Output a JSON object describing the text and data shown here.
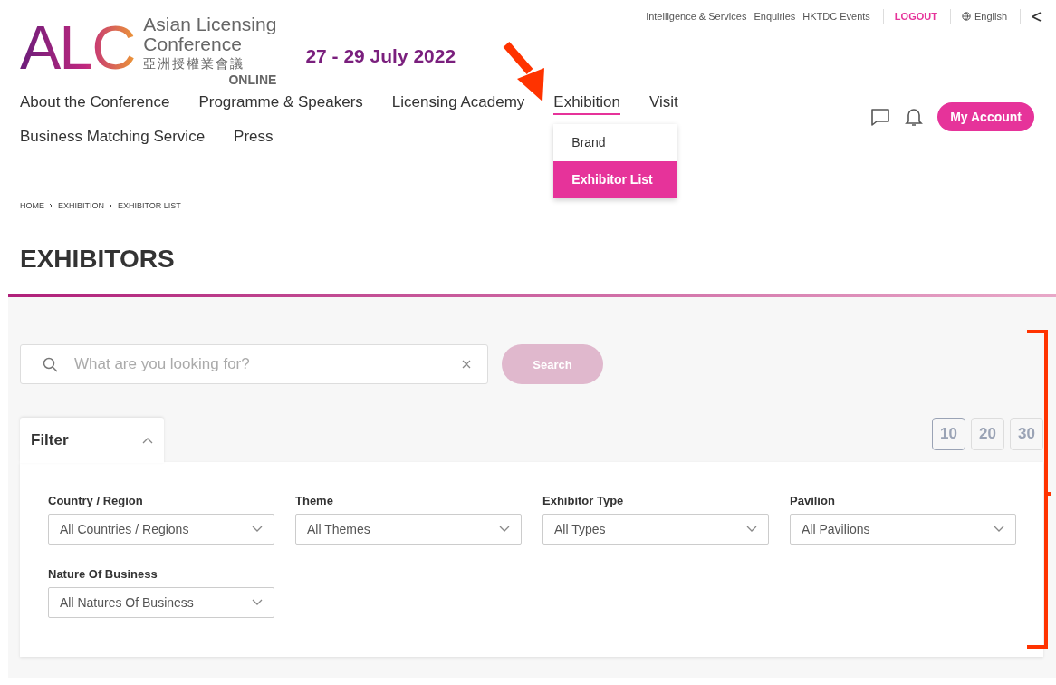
{
  "logo": {
    "mark": "ALC",
    "name_lines": [
      "Asian Licensing",
      "Conference"
    ],
    "chinese_name": "亞洲授權業會議",
    "edition": "ONLINE"
  },
  "event_date": "27 - 29 July 2022",
  "utility_links": [
    {
      "label": "Intelligence & Services",
      "kind": "link"
    },
    {
      "label": "Enquiries",
      "kind": "link"
    },
    {
      "label": "HKTDC Events",
      "kind": "link"
    },
    {
      "label": "LOGOUT",
      "kind": "logout"
    },
    {
      "label": "English",
      "kind": "language"
    },
    {
      "kind": "share"
    }
  ],
  "nav": [
    {
      "label": "About the Conference",
      "selected": false
    },
    {
      "label": "Programme & Speakers",
      "selected": false
    },
    {
      "label": "Licensing Academy",
      "selected": false
    },
    {
      "label": "Exhibition",
      "selected": true,
      "expanded": true,
      "children": [
        {
          "label": "Brand",
          "selected": false
        },
        {
          "label": "Exhibitor List",
          "selected": true
        }
      ]
    },
    {
      "label": "Visit",
      "selected": false
    },
    {
      "label": "Business Matching Service",
      "selected": false
    },
    {
      "label": "Press",
      "selected": false
    }
  ],
  "account_button": "My Account",
  "breadcrumb": [
    "HOME",
    "EXHIBITION",
    "EXHIBITOR LIST"
  ],
  "page_title": "EXHIBITORS",
  "search": {
    "placeholder": "What are you looking for?",
    "button": "Search",
    "disabled": true
  },
  "filter": {
    "title": "Filter",
    "expanded": true,
    "fields": [
      {
        "label": "Country / Region",
        "value": "All Countries / Regions"
      },
      {
        "label": "Theme",
        "value": "All Themes"
      },
      {
        "label": "Exhibitor Type",
        "value": "All Types"
      },
      {
        "label": "Pavilion",
        "value": "All Pavilions"
      },
      {
        "label": "Nature Of Business",
        "value": "All Natures Of Business"
      }
    ]
  },
  "page_sizes": [
    {
      "label": "10",
      "selected": true
    },
    {
      "label": "20",
      "selected": false
    },
    {
      "label": "30",
      "selected": false
    }
  ],
  "annotations": {
    "arrow": true,
    "bracket": true
  }
}
